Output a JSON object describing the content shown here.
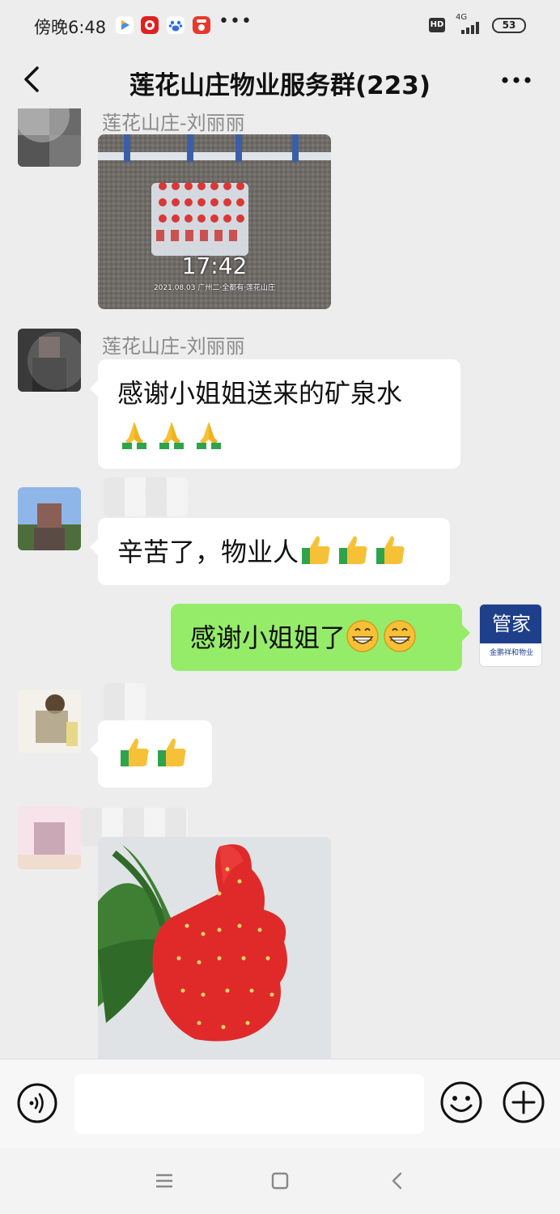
{
  "status_bar": {
    "time": "傍晚6:48",
    "more_indicator": "•••",
    "hd_label": "HD",
    "network": "4G",
    "battery": "53"
  },
  "nav": {
    "title": "莲花山庄物业服务群(223)"
  },
  "messages": [
    {
      "id": "m1",
      "sender": "莲花山庄-刘丽丽",
      "type": "image",
      "image_caption_time": "17:42",
      "image_caption_meta": "2021.08.03 广州二·全都有·莲花山庄"
    },
    {
      "id": "m2",
      "sender": "莲花山庄-刘丽丽",
      "type": "text",
      "text": "感谢小姐姐送来的矿泉水",
      "emoji": [
        "folded-hands",
        "folded-hands",
        "folded-hands"
      ]
    },
    {
      "id": "m3",
      "sender": "",
      "type": "text",
      "text": "辛苦了，物业人",
      "emoji": [
        "thumbs-up",
        "thumbs-up",
        "thumbs-up"
      ]
    },
    {
      "id": "m4",
      "sender": "管家",
      "type": "text",
      "self": true,
      "text": "感谢小姐姐了",
      "emoji": [
        "grinning-face",
        "grinning-face"
      ],
      "avatar_label": "管家",
      "avatar_sub": "金鹏祥和物业"
    },
    {
      "id": "m5",
      "sender": "",
      "type": "emoji",
      "emoji": [
        "thumbs-up",
        "thumbs-up"
      ]
    },
    {
      "id": "m6",
      "sender": "",
      "type": "image"
    }
  ],
  "colors": {
    "background": "#ededed",
    "self_bubble": "#95ec69",
    "other_bubble": "#ffffff",
    "sender_name": "#8a8a8a",
    "brand_avatar": "#1e3f8a"
  },
  "input_bar": {
    "voice_icon": "voice-icon",
    "emoji_icon": "smiley-icon",
    "more_icon": "plus-icon",
    "placeholder": ""
  },
  "system_nav": {
    "menu_icon": "menu-icon",
    "home_icon": "home-square-icon",
    "back_icon": "back-arrow-icon"
  }
}
